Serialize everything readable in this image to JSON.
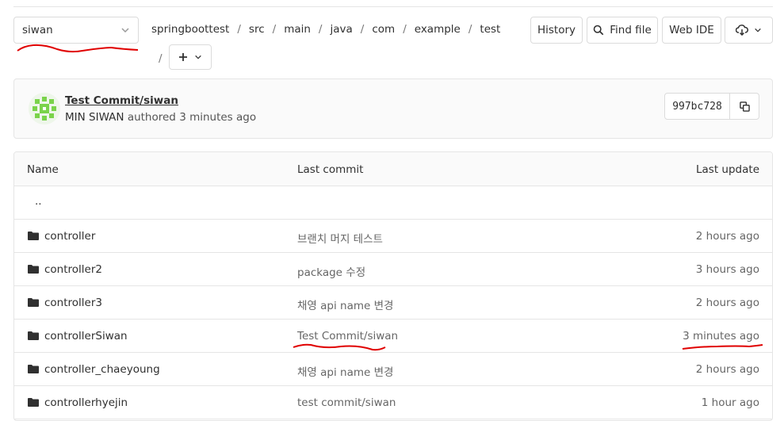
{
  "branch": {
    "name": "siwan"
  },
  "breadcrumb": [
    "springboottest",
    "src",
    "main",
    "java",
    "com",
    "example",
    "test"
  ],
  "toolbar": {
    "history": "History",
    "find_file": "Find file",
    "web_ide": "Web IDE"
  },
  "commit": {
    "title": "Test Commit/siwan",
    "author": "MIN SIWAN",
    "authored_text": "authored",
    "time": "3 minutes ago",
    "sha": "997bc728"
  },
  "table": {
    "headers": {
      "name": "Name",
      "last_commit": "Last commit",
      "last_update": "Last update"
    },
    "updir": "..",
    "rows": [
      {
        "name": "controller",
        "commit": "브랜치 머지 테스트",
        "updated": "2 hours ago"
      },
      {
        "name": "controller2",
        "commit": "package 수정",
        "updated": "3 hours ago"
      },
      {
        "name": "controller3",
        "commit": "채영 api name 변경",
        "updated": "2 hours ago"
      },
      {
        "name": "controllerSiwan",
        "commit": "Test Commit/siwan",
        "updated": "3 minutes ago"
      },
      {
        "name": "controller_chaeyoung",
        "commit": "채영 api name 변경",
        "updated": "2 hours ago"
      },
      {
        "name": "controllerhyejin",
        "commit": "test commit/siwan",
        "updated": "1 hour ago"
      }
    ]
  },
  "colors": {
    "annotation": "#e00000",
    "border": "#dbdbdb",
    "panel_bg": "#fafafa"
  }
}
